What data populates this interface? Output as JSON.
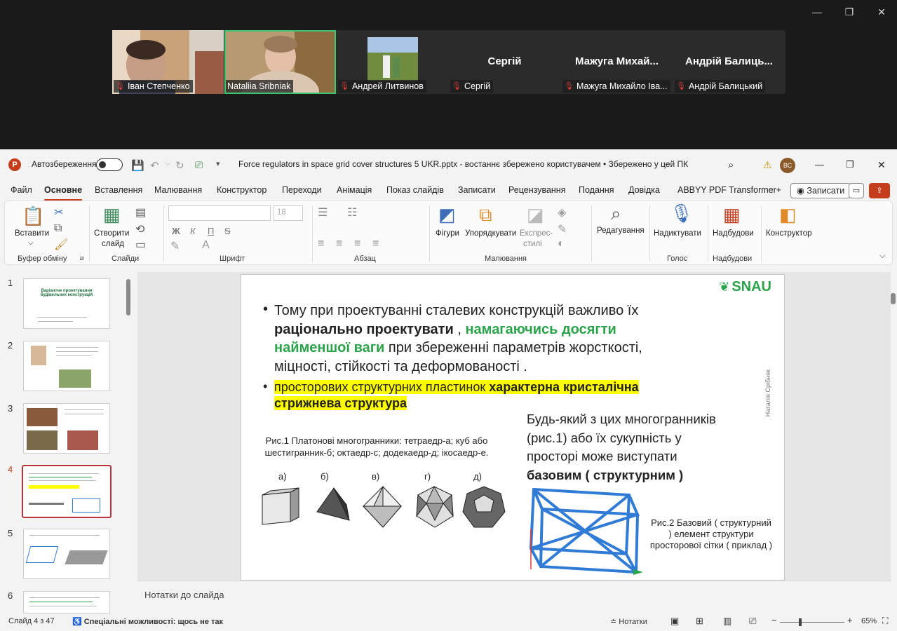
{
  "meeting": {
    "participants": [
      {
        "name": "Іван Степченко",
        "display": ""
      },
      {
        "name": "Nataliia Sribniak",
        "display": ""
      },
      {
        "name": "Андрей Литвинов",
        "display": ""
      },
      {
        "name": "Сергій",
        "display": "Сергій"
      },
      {
        "name": "Мажуга Михайло Іва...",
        "display": "Мажуга Михай..."
      },
      {
        "name": "Андрій Балицький",
        "display": "Андрій Балиць..."
      }
    ]
  },
  "ppt": {
    "autosave_label": "Автозбереження",
    "doc_title": "Force regulators in space grid cover structures 5 UKR.pptx  -  востаннє збережено користувачем  •  Збережено у цей ПК",
    "avatar_initials": "ВС",
    "menu": [
      "Файл",
      "Основне",
      "Вставлення",
      "Малювання",
      "Конструктор",
      "Переходи",
      "Анімація",
      "Показ слайдів",
      "Записати",
      "Рецензування",
      "Подання",
      "Довідка",
      "ABBYY PDF Transformer+"
    ],
    "record_button": "Записати",
    "ribbon": {
      "paste": "Вставити",
      "new_slide_1": "Створити",
      "new_slide_2": "слайд",
      "font_size": "18",
      "shapes": "Фігури",
      "arrange": "Упорядкувати",
      "quick_styles_1": "Експрес-",
      "quick_styles_2": "стилі",
      "editing": "Редагування",
      "dictate": "Надиктувати",
      "addins": "Надбудови",
      "designer": "Конструктор",
      "groups": [
        "Буфер обміну",
        "Слайди",
        "Шрифт",
        "Абзац",
        "Малювання",
        "Голос",
        "Надбудови"
      ],
      "bold": "Ж",
      "italic": "К",
      "underline": "П",
      "strike": "S"
    },
    "thumbnails": [
      "1",
      "2",
      "3",
      "4",
      "5",
      "6"
    ],
    "thumb1": {
      "title": "Варіантне проектування будівельних конструкцій"
    },
    "slide": {
      "logo": "SNAU",
      "b1_l1": "Тому при проектуванні сталевих конструкцій важливо їх",
      "b1_l2a": "раціонально проектувати",
      "b1_l2b": " , ",
      "b1_l2c": "намагаючись досягти",
      "b1_l3a": "найменшої ваги",
      "b1_l3b": " при збереженні параметрів жорсткості,",
      "b1_l4": "міцності, стійкості та деформованості .",
      "b2_l1a": "просторових структурних пластинок ",
      "b2_l1b": "характерна кристалічна",
      "b2_l2": "стрижнева структура",
      "fig1_caption": "Рис.1 Платонові многогранники: тетраедр-а; куб або шестигранник-б; октаедр-с; додекаедр-д; ікосаедр-е.",
      "fig_letters": [
        "а)",
        "б)",
        "в)",
        "г)",
        "д)"
      ],
      "right_p1": "Будь-який з цих многогранників",
      "right_p2": "(рис.1) або їх сукупність у",
      "right_p3": "просторі може виступати",
      "right_p4": "базовим ( структурним )",
      "fig2_caption": "Рис.2 Базовий ( структурний ) елемент структури просторової сітки ( приклад )",
      "vertical_author": "Наталія Срібняк"
    },
    "notes_placeholder": "Нотатки до слайда",
    "status": {
      "slide_info": "Слайд 4 з 47",
      "accessibility": "Спеціальні можливості: щось не так",
      "notes_btn": "Нотатки",
      "zoom": "65%"
    }
  }
}
